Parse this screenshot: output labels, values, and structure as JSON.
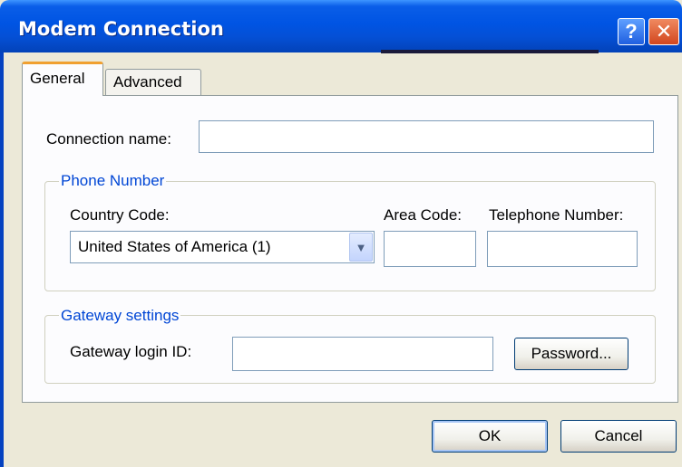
{
  "window": {
    "title": "Modem Connection"
  },
  "titlebar": {
    "help_glyph": "?",
    "close_glyph": "✕"
  },
  "tabs": [
    {
      "label": "General",
      "selected": true
    },
    {
      "label": "Advanced",
      "selected": false
    }
  ],
  "general": {
    "connection_name_label": "Connection name:",
    "connection_name_value": "",
    "phone_group_title": "Phone Number",
    "country_code_label": "Country Code:",
    "country_code_selected": "United States of America (1)",
    "area_code_label": "Area Code:",
    "area_code_value": "",
    "telephone_label": "Telephone Number:",
    "telephone_value": "",
    "gateway_group_title": "Gateway settings",
    "gateway_login_label": "Gateway login ID:",
    "gateway_login_value": "",
    "password_button": "Password..."
  },
  "footer": {
    "ok_label": "OK",
    "cancel_label": "Cancel"
  },
  "colors": {
    "titlebar": "#0054e3",
    "group_title": "#0046d5",
    "dialog_bg": "#ece9d8",
    "tab_accent": "#f0a030"
  }
}
